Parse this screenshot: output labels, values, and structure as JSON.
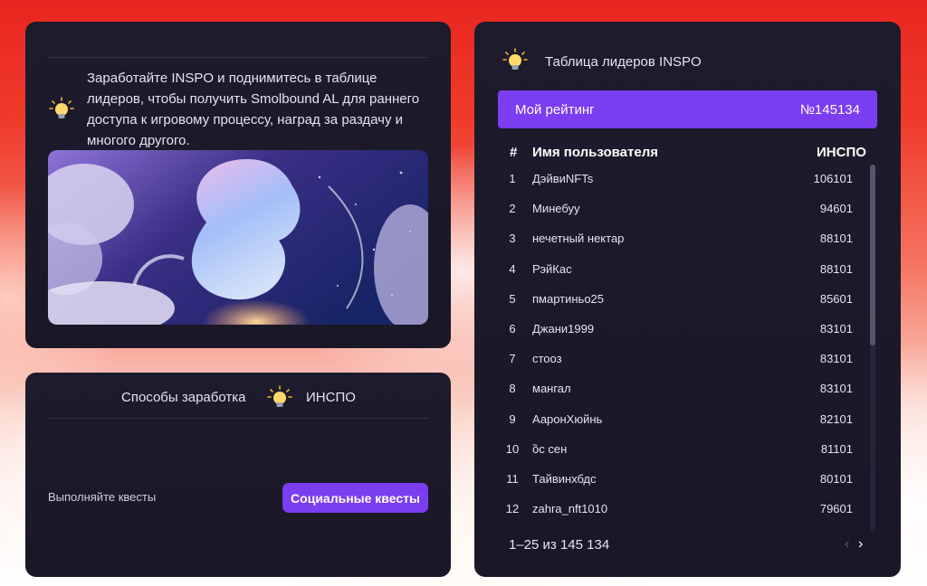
{
  "intro": {
    "text": "Заработайте INSPO и поднимитесь в таблице лидеров, чтобы получить Smolbound AL для раннего доступа к игровому процессу, наград за раздачу и многого другого."
  },
  "earn": {
    "title_left": "Способы заработка",
    "title_right": "ИНСПО",
    "quest_label": "Выполняйте квесты",
    "quest_button": "Социальные квесты"
  },
  "leaderboard": {
    "title": "Таблица лидеров INSPO",
    "my_rank_label": "Мой рейтинг",
    "my_rank_value": "№145134",
    "headers": {
      "rank": "#",
      "name": "Имя пользователя",
      "score": "ИНСПО"
    },
    "rows": [
      {
        "rank": "1",
        "name": "ДэйвиNFTs",
        "score": "106101"
      },
      {
        "rank": "2",
        "name": "Минебуу",
        "score": "94601"
      },
      {
        "rank": "3",
        "name": "нечетный нектар",
        "score": "88101"
      },
      {
        "rank": "4",
        "name": "РэйКас",
        "score": "88101"
      },
      {
        "rank": "5",
        "name": "пмартиньо25",
        "score": "85601"
      },
      {
        "rank": "6",
        "name": "Джани1999",
        "score": "83101"
      },
      {
        "rank": "7",
        "name": "стооз",
        "score": "83101"
      },
      {
        "rank": "8",
        "name": "мангал",
        "score": "83101"
      },
      {
        "rank": "9",
        "name": "АаронХюйнь",
        "score": "82101"
      },
      {
        "rank": "10",
        "name": "ồс сен",
        "score": "81101"
      },
      {
        "rank": "11",
        "name": "Тайвинхбдс",
        "score": "80101"
      },
      {
        "rank": "12",
        "name": "zahra_nft1010",
        "score": "79601"
      }
    ],
    "pagination": "1–25 из 145 134",
    "prev_icon": "‹",
    "next_icon": "›"
  },
  "icons": {
    "bulb": "lightbulb-icon"
  },
  "colors": {
    "accent": "#7a3df0",
    "panel": "#1d1b2c",
    "background_top": "#e8261f"
  }
}
